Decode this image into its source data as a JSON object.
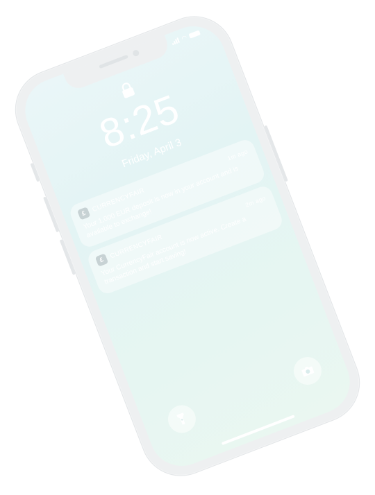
{
  "lock_screen": {
    "time": "8:25",
    "date": "Friday, April 3"
  },
  "notifications": [
    {
      "app": "CURRENCYFAIR",
      "time": "1m ago",
      "icon": "currencyfair-app-icon",
      "message": "Your 1,000 EUR deposit is now in your account and is available to exchange!"
    },
    {
      "app": "CURRENCYFAIR",
      "time": "2m ago",
      "icon": "currencyfair-app-icon",
      "message": "Your CurrencyFair account is now active. Create a transaction and start saving!"
    }
  ],
  "quick_actions": {
    "flashlight_icon": "flashlight-icon",
    "camera_icon": "camera-icon"
  },
  "colors": {
    "screen_background": "#e4f4f3",
    "frame": "#eef0f1",
    "text": "#ffffff"
  }
}
